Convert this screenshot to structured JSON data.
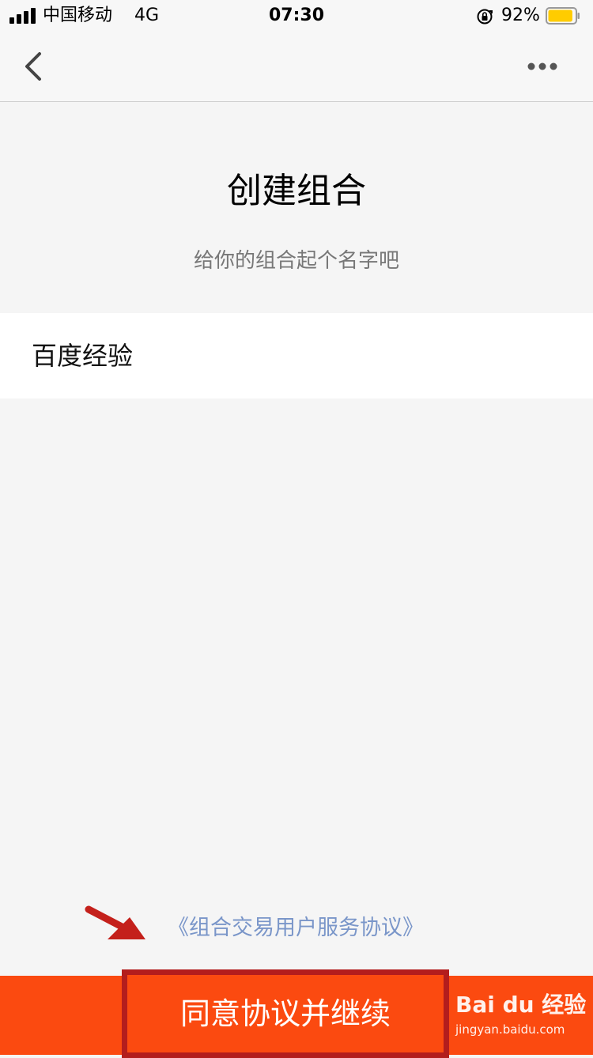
{
  "status_bar": {
    "carrier": "中国移动",
    "network": "4G",
    "time": "07:30",
    "battery_percent": "92%",
    "battery_level": 0.92,
    "battery_color": "#ffcc00",
    "icons": [
      "signal-icon",
      "orientation-lock-icon",
      "battery-icon"
    ]
  },
  "nav": {
    "back_icon": "chevron-left-icon",
    "more_icon": "more-dots-icon"
  },
  "header": {
    "title": "创建组合",
    "subtitle": "给你的组合起个名字吧"
  },
  "name_input": {
    "value": "百度经验"
  },
  "agreement": {
    "link_text": "《组合交易用户服务协议》",
    "link_color": "#7a96c9"
  },
  "action": {
    "agree_label": "同意协议并继续",
    "button_color": "#fb4a10",
    "highlight_color": "#b31d1d"
  },
  "watermark": {
    "brand": "Bai du 经验",
    "url": "jingyan.baidu.com"
  }
}
